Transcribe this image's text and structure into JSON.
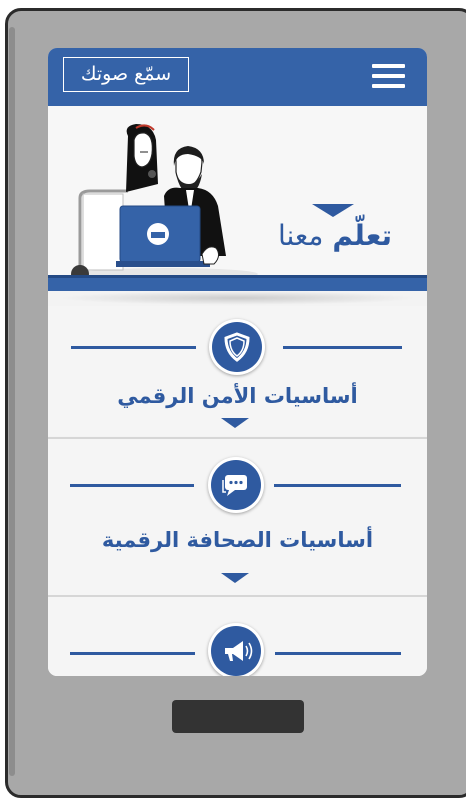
{
  "app": {
    "logo_text": "سمّع صوتك",
    "menu_icon": "hamburger-menu-icon"
  },
  "hero": {
    "title_strong": "تعلّم",
    "title_rest": " معنا",
    "illustration": "two-people-laptop-illustration"
  },
  "sections": [
    {
      "title": "أساسيات الأمن الرقمي",
      "icon": "shield-icon"
    },
    {
      "title": "أساسيات الصحافة الرقمية",
      "icon": "chat-bubble-icon"
    },
    {
      "title": "",
      "icon": "megaphone-icon"
    }
  ],
  "colors": {
    "brand": "#3563a8",
    "text_blue": "#2f5aa0",
    "phone_frame": "#a8a8a8"
  }
}
